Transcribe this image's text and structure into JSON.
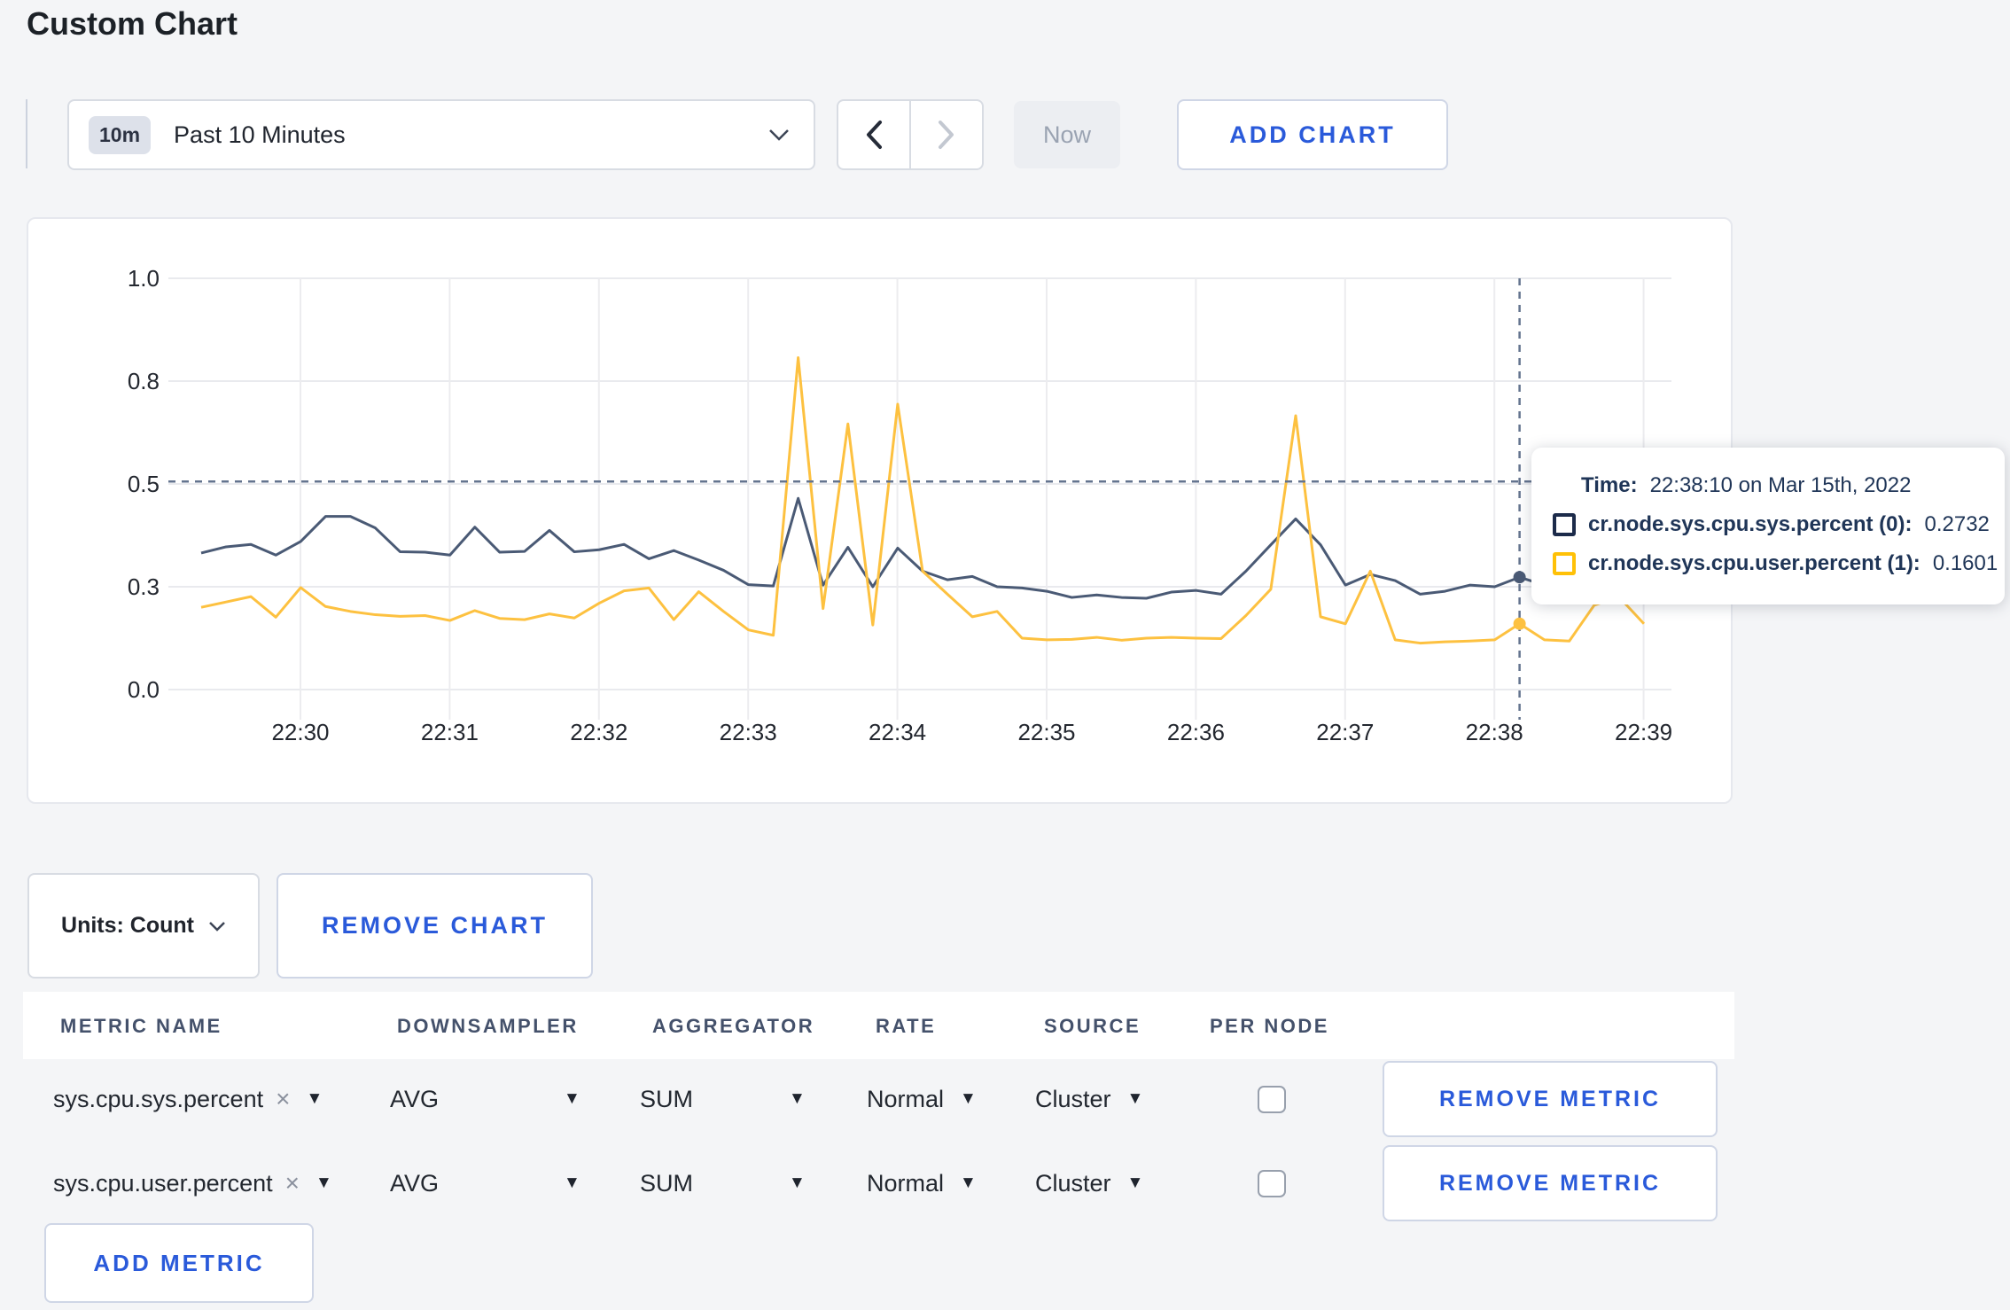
{
  "page": {
    "title": "Custom Chart"
  },
  "toolbar": {
    "range_badge": "10m",
    "range_label": "Past 10 Minutes",
    "now_label": "Now",
    "add_chart_label": "ADD CHART"
  },
  "chart_data": {
    "type": "line",
    "title": "",
    "xlabel": "",
    "ylabel": "",
    "ylim": [
      0,
      1
    ],
    "grid": true,
    "legend_position": "none",
    "start_time": "22:29:20",
    "interval_seconds": 10,
    "x_ticks": [
      "22:30",
      "22:31",
      "22:32",
      "22:33",
      "22:34",
      "22:35",
      "22:36",
      "22:37",
      "22:38",
      "22:39"
    ],
    "y_ticks": [
      {
        "label": "1.0",
        "pos": 1.0
      },
      {
        "label": "0.8",
        "pos": 0.75
      },
      {
        "label": "0.5",
        "pos": 0.5
      },
      {
        "label": "0.3",
        "pos": 0.25
      },
      {
        "label": "0.0",
        "pos": 0.0
      }
    ],
    "series": [
      {
        "name": "cr.node.sys.cpu.sys.percent",
        "color": "#4a5a75",
        "values": [
          0.332,
          0.347,
          0.353,
          0.327,
          0.36,
          0.421,
          0.421,
          0.393,
          0.335,
          0.334,
          0.327,
          0.395,
          0.334,
          0.336,
          0.387,
          0.335,
          0.34,
          0.353,
          0.318,
          0.338,
          0.315,
          0.29,
          0.255,
          0.252,
          0.465,
          0.254,
          0.346,
          0.25,
          0.344,
          0.288,
          0.267,
          0.275,
          0.25,
          0.247,
          0.239,
          0.224,
          0.23,
          0.224,
          0.222,
          0.237,
          0.241,
          0.232,
          0.288,
          0.352,
          0.415,
          0.352,
          0.254,
          0.28,
          0.265,
          0.232,
          0.239,
          0.254,
          0.25,
          0.2732,
          0.254,
          0.27,
          0.28,
          0.295,
          0.3
        ]
      },
      {
        "name": "cr.node.sys.cpu.user.percent",
        "color": "#fdc140",
        "values": [
          0.2,
          0.213,
          0.226,
          0.176,
          0.248,
          0.202,
          0.19,
          0.182,
          0.178,
          0.18,
          0.168,
          0.192,
          0.173,
          0.17,
          0.184,
          0.174,
          0.21,
          0.24,
          0.247,
          0.17,
          0.238,
          0.19,
          0.145,
          0.132,
          0.807,
          0.197,
          0.646,
          0.157,
          0.694,
          0.288,
          0.232,
          0.177,
          0.19,
          0.125,
          0.121,
          0.122,
          0.127,
          0.12,
          0.125,
          0.127,
          0.125,
          0.124,
          0.18,
          0.244,
          0.666,
          0.177,
          0.16,
          0.288,
          0.121,
          0.113,
          0.116,
          0.118,
          0.121,
          0.1601,
          0.121,
          0.118,
          0.205,
          0.225,
          0.16
        ]
      }
    ],
    "hover": {
      "index": 53,
      "time": "22:38:10",
      "crosshair_y_value": 0.506
    }
  },
  "tooltip": {
    "time_label": "Time:",
    "time_value": "22:38:10 on Mar 15th, 2022",
    "series": [
      {
        "name": "cr.node.sys.cpu.sys.percent (0):",
        "value": "0.2732",
        "swatch_color": "#1c2b4a"
      },
      {
        "name": "cr.node.sys.cpu.user.percent (1):",
        "value": "0.1601",
        "swatch_color": "#ffc107"
      }
    ]
  },
  "units_bar": {
    "units_label": "Units: Count",
    "remove_chart_label": "REMOVE CHART"
  },
  "metrics_table": {
    "headers": [
      "METRIC NAME",
      "DOWNSAMPLER",
      "AGGREGATOR",
      "RATE",
      "SOURCE",
      "PER NODE"
    ],
    "rows": [
      {
        "metric": "sys.cpu.sys.percent",
        "downsampler": "AVG",
        "aggregator": "SUM",
        "rate": "Normal",
        "source": "Cluster",
        "per_node_checked": false,
        "remove_label": "REMOVE METRIC"
      },
      {
        "metric": "sys.cpu.user.percent",
        "downsampler": "AVG",
        "aggregator": "SUM",
        "rate": "Normal",
        "source": "Cluster",
        "per_node_checked": false,
        "remove_label": "REMOVE METRIC"
      }
    ],
    "add_metric_label": "ADD METRIC"
  }
}
